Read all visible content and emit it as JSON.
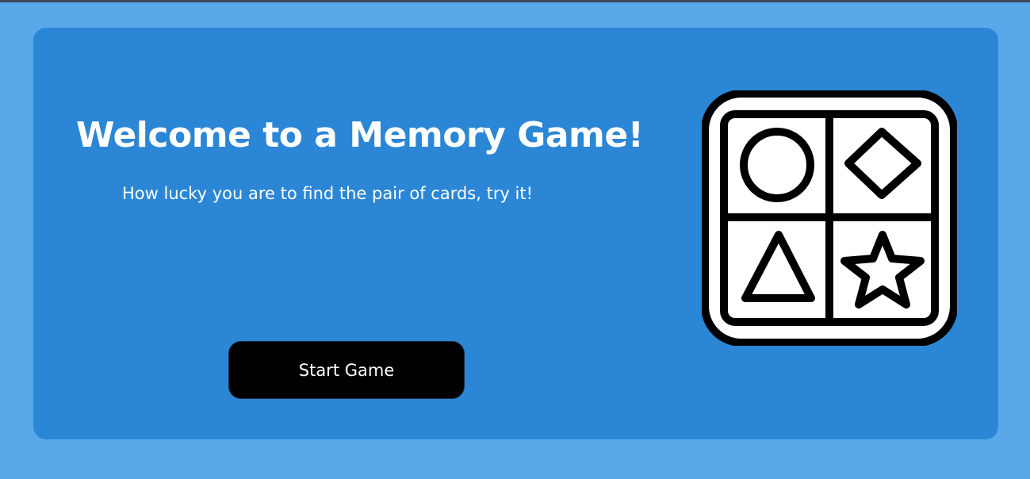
{
  "hero": {
    "title": "Welcome to a Memory Game!",
    "subtitle": "How lucky you are to find the pair of cards, try it!",
    "start_button_label": "Start Game"
  },
  "logo": {
    "icon": "memory-shapes-grid-icon",
    "shapes": [
      "circle",
      "diamond",
      "triangle",
      "star"
    ]
  },
  "colors": {
    "page_background": "#5aa8ea",
    "panel_background": "#2b86d6",
    "button_background": "#000000",
    "text": "#ffffff"
  }
}
